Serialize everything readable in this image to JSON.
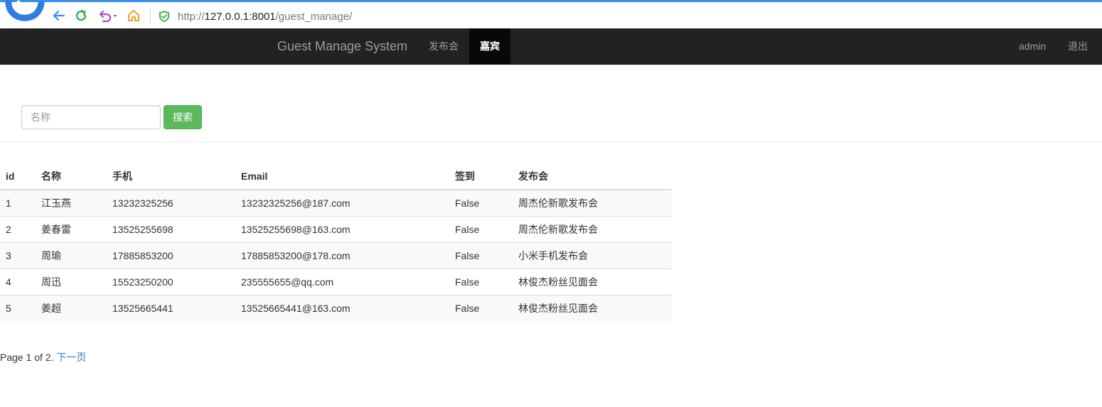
{
  "browser": {
    "url_scheme": "http://",
    "url_host": "127.0.0.1:8001",
    "url_path": "/guest_manage/",
    "icons": [
      "back-arrow-icon",
      "reload-icon",
      "undo-icon",
      "home-icon",
      "shield-icon"
    ]
  },
  "navbar": {
    "brand": "Guest Manage System",
    "items": [
      {
        "label": "发布会"
      },
      {
        "label": "嘉宾"
      }
    ],
    "user": "admin",
    "logout": "退出"
  },
  "search": {
    "placeholder": "名称",
    "button": "搜索"
  },
  "table": {
    "headers": [
      "id",
      "名称",
      "手机",
      "Email",
      "签到",
      "发布会"
    ],
    "rows": [
      [
        "1",
        "江玉燕",
        "13232325256",
        "13232325256@187.com",
        "False",
        "周杰伦新歌发布会"
      ],
      [
        "2",
        "姜春雷",
        "13525255698",
        "13525255698@163.com",
        "False",
        "周杰伦新歌发布会"
      ],
      [
        "3",
        "周瑜",
        "17885853200",
        "17885853200@178.com",
        "False",
        "小米手机发布会"
      ],
      [
        "4",
        "周迅",
        "15523250200",
        "235555655@qq.com",
        "False",
        "林俊杰粉丝见面会"
      ],
      [
        "5",
        "姜超",
        "13525665441",
        "13525665441@163.com",
        "False",
        "林俊杰粉丝见面会"
      ]
    ]
  },
  "pagination": {
    "text": "Page 1 of 2.",
    "next": "下一页"
  },
  "colors": {
    "navbar_bg": "#222222",
    "navbar_active": "#080808",
    "search_button": "#5cb85c",
    "link": "#337ab7"
  }
}
